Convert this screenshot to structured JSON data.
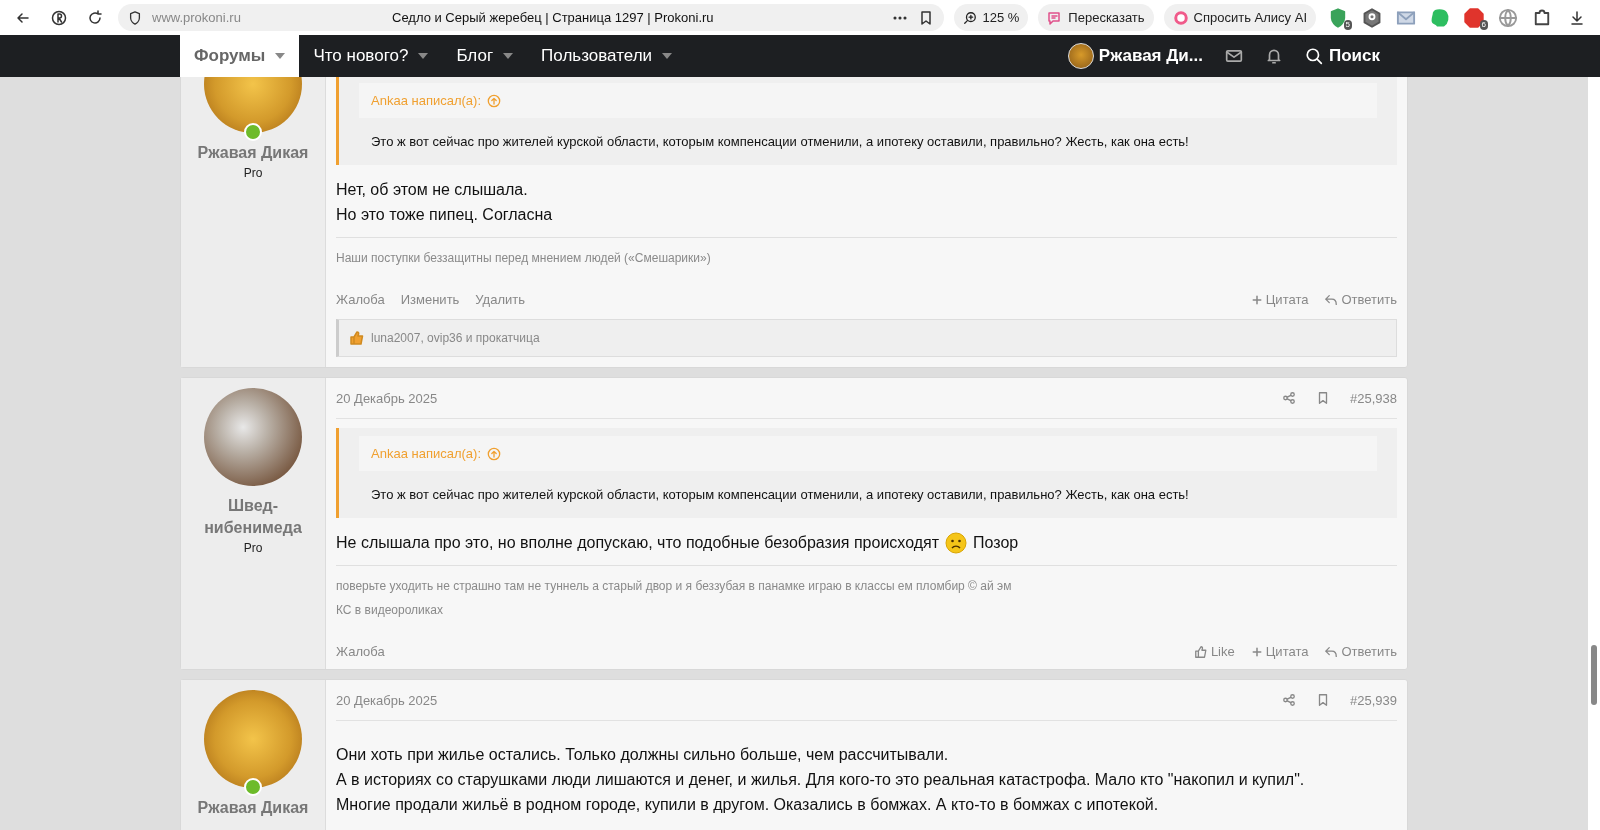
{
  "browser": {
    "url": "www.prokoni.ru",
    "title": "Седло и Серый жеребец | Страница 1297 | Prokoni.ru",
    "zoom": "125 %",
    "retell": "Пересказать",
    "ask": "Спросить Алису AI",
    "extensions": [
      {
        "kind": "shield",
        "badge": "5"
      },
      {
        "kind": "hex"
      },
      {
        "kind": "mail"
      },
      {
        "kind": "elephant"
      },
      {
        "kind": "adblock",
        "badge": "6"
      },
      {
        "kind": "globe"
      },
      {
        "kind": "puzzle"
      }
    ]
  },
  "nav": {
    "tabs": [
      {
        "label": "Форумы",
        "selected": true
      },
      {
        "label": "Что нового?",
        "selected": false
      },
      {
        "label": "Блог",
        "selected": false
      },
      {
        "label": "Пользователи",
        "selected": false
      }
    ],
    "user": "Ржавая Ди...",
    "search": "Поиск"
  },
  "posts": [
    {
      "user": {
        "name": "Ржавая Дикая",
        "title": "Pro",
        "online": true,
        "kind": "cartoon"
      },
      "quote": {
        "author": "Ankaa написал(а):",
        "text": "Это ж вот сейчас про жителей курской области, которым компенсации отменили, а ипотеку оставили, правильно? Жесть, как она есть!"
      },
      "body": [
        [
          {
            "kind": "text",
            "text": "Нет, об этом не слышала."
          }
        ],
        [
          {
            "kind": "text",
            "text": "Но это тоже пипец. Согласна"
          }
        ]
      ],
      "signature": [
        "Наши поступки беззащитны перед мнением людей («Смешарики»)"
      ],
      "actions_left": [
        "Жалоба",
        "Изменить",
        "Удалить"
      ],
      "actions_right": [
        {
          "kind": "quote",
          "label": "Цитата"
        },
        {
          "kind": "reply",
          "label": "Ответить"
        }
      ],
      "likes": "luna2007, ovip36 и прокатчица"
    },
    {
      "user": {
        "name": "Швед-нибенимеда",
        "title": "Pro",
        "online": false,
        "kind": "photo"
      },
      "date": "20 Декабрь 2025",
      "number": "#25,938",
      "quote": {
        "author": "Ankaa написал(а):",
        "text": "Это ж вот сейчас про жителей курской области, которым компенсации отменили, а ипотеку оставили, правильно? Жесть, как она есть!"
      },
      "body": [
        [
          {
            "kind": "text",
            "text": "Не слышала про это, но вполне допускаю, что подобные безобразия происходят"
          },
          {
            "kind": "frown"
          },
          {
            "kind": "text",
            "text": "Позор"
          }
        ]
      ],
      "signature": [
        "поверьте уходить не страшно там не туннель а старый двор и я беззубая в панамке играю в классы ем пломбир © ай эм",
        "КС в видеороликах"
      ],
      "actions_left": [
        "Жалоба"
      ],
      "actions_right": [
        {
          "kind": "like",
          "label": "Like"
        },
        {
          "kind": "quote",
          "label": "Цитата"
        },
        {
          "kind": "reply",
          "label": "Ответить"
        }
      ]
    },
    {
      "user": {
        "name": "Ржавая Дикая",
        "online": true,
        "kind": "cartoon"
      },
      "date": "20 Декабрь 2025",
      "number": "#25,939",
      "body": [
        [
          {
            "kind": "text",
            "text": "Они хоть при жилье остались. Только должны сильно больше, чем рассчитывали."
          }
        ],
        [
          {
            "kind": "text",
            "text": "А в историях со старушками люди лишаются и денег, и жилья. Для кого-то это реальная катастрофа. Мало кто \"накопил и купил\"."
          }
        ],
        [
          {
            "kind": "text",
            "text": "Многие продали жильё в родном городе, купили в другом. Оказались в бомжах. А кто-то в бомжах с ипотекой."
          }
        ]
      ]
    }
  ]
}
